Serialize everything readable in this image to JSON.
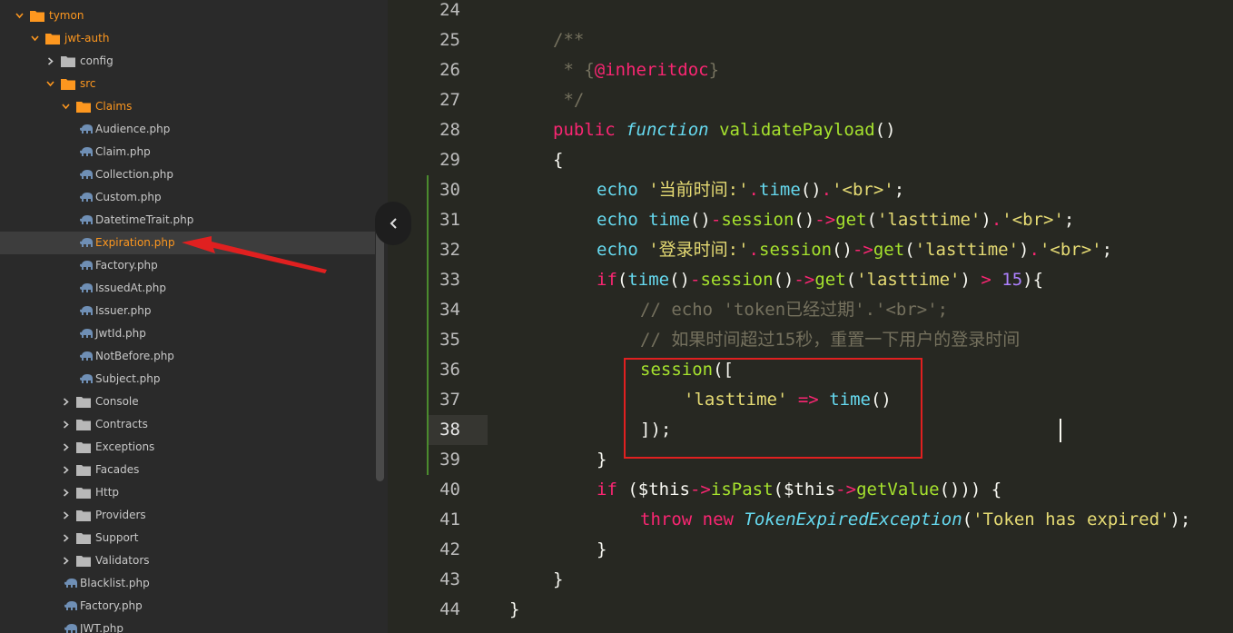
{
  "sidebar": {
    "items": [
      {
        "label": "tymon",
        "type": "folder",
        "expanded": true,
        "level": 0,
        "color": "orange"
      },
      {
        "label": "jwt-auth",
        "type": "folder",
        "expanded": true,
        "level": 1,
        "color": "orange"
      },
      {
        "label": "config",
        "type": "folder",
        "expanded": false,
        "level": 2,
        "color": "grey"
      },
      {
        "label": "src",
        "type": "folder",
        "expanded": true,
        "level": 2,
        "color": "orange"
      },
      {
        "label": "Claims",
        "type": "folder",
        "expanded": true,
        "level": 3,
        "color": "orange"
      },
      {
        "label": "Audience.php",
        "type": "file",
        "level": 4
      },
      {
        "label": "Claim.php",
        "type": "file",
        "level": 4
      },
      {
        "label": "Collection.php",
        "type": "file",
        "level": 4
      },
      {
        "label": "Custom.php",
        "type": "file",
        "level": 4
      },
      {
        "label": "DatetimeTrait.php",
        "type": "file",
        "level": 4
      },
      {
        "label": "Expiration.php",
        "type": "file",
        "level": 4,
        "selected": true
      },
      {
        "label": "Factory.php",
        "type": "file",
        "level": 4
      },
      {
        "label": "IssuedAt.php",
        "type": "file",
        "level": 4
      },
      {
        "label": "Issuer.php",
        "type": "file",
        "level": 4
      },
      {
        "label": "JwtId.php",
        "type": "file",
        "level": 4
      },
      {
        "label": "NotBefore.php",
        "type": "file",
        "level": 4
      },
      {
        "label": "Subject.php",
        "type": "file",
        "level": 4
      },
      {
        "label": "Console",
        "type": "folder",
        "expanded": false,
        "level": 3,
        "color": "grey"
      },
      {
        "label": "Contracts",
        "type": "folder",
        "expanded": false,
        "level": 3,
        "color": "grey"
      },
      {
        "label": "Exceptions",
        "type": "folder",
        "expanded": false,
        "level": 3,
        "color": "grey"
      },
      {
        "label": "Facades",
        "type": "folder",
        "expanded": false,
        "level": 3,
        "color": "grey"
      },
      {
        "label": "Http",
        "type": "folder",
        "expanded": false,
        "level": 3,
        "color": "grey"
      },
      {
        "label": "Providers",
        "type": "folder",
        "expanded": false,
        "level": 3,
        "color": "grey"
      },
      {
        "label": "Support",
        "type": "folder",
        "expanded": false,
        "level": 3,
        "color": "grey"
      },
      {
        "label": "Validators",
        "type": "folder",
        "expanded": false,
        "level": 3,
        "color": "grey"
      },
      {
        "label": "Blacklist.php",
        "type": "file",
        "level": 3
      },
      {
        "label": "Factory.php",
        "type": "file",
        "level": 3
      },
      {
        "label": "JWT.php",
        "type": "file",
        "level": 3
      }
    ]
  },
  "editor": {
    "line_numbers": [
      "24",
      "25",
      "26",
      "27",
      "28",
      "29",
      "30",
      "31",
      "32",
      "33",
      "34",
      "35",
      "36",
      "37",
      "38",
      "39",
      "40",
      "41",
      "42",
      "43",
      "44"
    ],
    "active_line": "38",
    "lines": [
      [],
      [
        {
          "t": "/**",
          "c": "c-com"
        }
      ],
      [
        {
          "t": " * ",
          "c": "c-com"
        },
        {
          "t": "{",
          "c": "c-com"
        },
        {
          "t": "@inheritdoc",
          "c": "c-kw"
        },
        {
          "t": "}",
          "c": "c-com"
        }
      ],
      [
        {
          "t": " */",
          "c": "c-com"
        }
      ],
      [
        {
          "t": "public",
          "c": "c-kw"
        },
        {
          "t": " ",
          "c": "c-plain"
        },
        {
          "t": "function",
          "c": "c-type"
        },
        {
          "t": " ",
          "c": "c-plain"
        },
        {
          "t": "validatePayload",
          "c": "c-fn"
        },
        {
          "t": "()",
          "c": "c-plain"
        }
      ],
      [
        {
          "t": "{",
          "c": "c-plain"
        }
      ],
      [
        {
          "t": "echo",
          "c": "c-bi"
        },
        {
          "t": " ",
          "c": "c-plain"
        },
        {
          "t": "'当前时间:'",
          "c": "c-str"
        },
        {
          "t": ".",
          "c": "c-kw"
        },
        {
          "t": "time",
          "c": "c-bi"
        },
        {
          "t": "()",
          "c": "c-plain"
        },
        {
          "t": ".",
          "c": "c-kw"
        },
        {
          "t": "'<br>'",
          "c": "c-str"
        },
        {
          "t": ";",
          "c": "c-plain"
        }
      ],
      [
        {
          "t": "echo",
          "c": "c-bi"
        },
        {
          "t": " ",
          "c": "c-plain"
        },
        {
          "t": "time",
          "c": "c-bi"
        },
        {
          "t": "()",
          "c": "c-plain"
        },
        {
          "t": "-",
          "c": "c-kw"
        },
        {
          "t": "session",
          "c": "c-fn"
        },
        {
          "t": "()",
          "c": "c-plain"
        },
        {
          "t": "->",
          "c": "c-kw"
        },
        {
          "t": "get",
          "c": "c-fn"
        },
        {
          "t": "(",
          "c": "c-plain"
        },
        {
          "t": "'lasttime'",
          "c": "c-str"
        },
        {
          "t": ")",
          "c": "c-plain"
        },
        {
          "t": ".",
          "c": "c-kw"
        },
        {
          "t": "'<br>'",
          "c": "c-str"
        },
        {
          "t": ";",
          "c": "c-plain"
        }
      ],
      [
        {
          "t": "echo",
          "c": "c-bi"
        },
        {
          "t": " ",
          "c": "c-plain"
        },
        {
          "t": "'登录时间:'",
          "c": "c-str"
        },
        {
          "t": ".",
          "c": "c-kw"
        },
        {
          "t": "session",
          "c": "c-fn"
        },
        {
          "t": "()",
          "c": "c-plain"
        },
        {
          "t": "->",
          "c": "c-kw"
        },
        {
          "t": "get",
          "c": "c-fn"
        },
        {
          "t": "(",
          "c": "c-plain"
        },
        {
          "t": "'lasttime'",
          "c": "c-str"
        },
        {
          "t": ")",
          "c": "c-plain"
        },
        {
          "t": ".",
          "c": "c-kw"
        },
        {
          "t": "'<br>'",
          "c": "c-str"
        },
        {
          "t": ";",
          "c": "c-plain"
        }
      ],
      [
        {
          "t": "if",
          "c": "c-kw"
        },
        {
          "t": "(",
          "c": "c-plain"
        },
        {
          "t": "time",
          "c": "c-bi"
        },
        {
          "t": "()",
          "c": "c-plain"
        },
        {
          "t": "-",
          "c": "c-kw"
        },
        {
          "t": "session",
          "c": "c-fn"
        },
        {
          "t": "()",
          "c": "c-plain"
        },
        {
          "t": "->",
          "c": "c-kw"
        },
        {
          "t": "get",
          "c": "c-fn"
        },
        {
          "t": "(",
          "c": "c-plain"
        },
        {
          "t": "'lasttime'",
          "c": "c-str"
        },
        {
          "t": ") ",
          "c": "c-plain"
        },
        {
          "t": ">",
          "c": "c-kw"
        },
        {
          "t": " ",
          "c": "c-plain"
        },
        {
          "t": "15",
          "c": "c-num"
        },
        {
          "t": "){",
          "c": "c-plain"
        }
      ],
      [
        {
          "t": "// echo 'token已经过期'.'<br>';",
          "c": "c-com"
        }
      ],
      [
        {
          "t": "// 如果时间超过15秒，重置一下用户的登录时间",
          "c": "c-com"
        }
      ],
      [
        {
          "t": "session",
          "c": "c-fn"
        },
        {
          "t": "([",
          "c": "c-plain"
        }
      ],
      [
        {
          "t": "'lasttime'",
          "c": "c-str"
        },
        {
          "t": " ",
          "c": "c-plain"
        },
        {
          "t": "=>",
          "c": "c-kw"
        },
        {
          "t": " ",
          "c": "c-plain"
        },
        {
          "t": "time",
          "c": "c-bi"
        },
        {
          "t": "()",
          "c": "c-plain"
        }
      ],
      [
        {
          "t": "]);",
          "c": "c-plain"
        }
      ],
      [
        {
          "t": "}",
          "c": "c-plain"
        }
      ],
      [
        {
          "t": "if",
          "c": "c-kw"
        },
        {
          "t": " (",
          "c": "c-plain"
        },
        {
          "t": "$this",
          "c": "c-plain"
        },
        {
          "t": "->",
          "c": "c-kw"
        },
        {
          "t": "isPast",
          "c": "c-fn"
        },
        {
          "t": "(",
          "c": "c-plain"
        },
        {
          "t": "$this",
          "c": "c-plain"
        },
        {
          "t": "->",
          "c": "c-kw"
        },
        {
          "t": "getValue",
          "c": "c-fn"
        },
        {
          "t": "())) {",
          "c": "c-plain"
        }
      ],
      [
        {
          "t": "throw",
          "c": "c-kw"
        },
        {
          "t": " ",
          "c": "c-plain"
        },
        {
          "t": "new",
          "c": "c-kw"
        },
        {
          "t": " ",
          "c": "c-plain"
        },
        {
          "t": "TokenExpiredException",
          "c": "c-ital"
        },
        {
          "t": "(",
          "c": "c-plain"
        },
        {
          "t": "'Token has expired'",
          "c": "c-str"
        },
        {
          "t": ");",
          "c": "c-plain"
        }
      ],
      [
        {
          "t": "}",
          "c": "c-plain"
        }
      ],
      [
        {
          "t": "}",
          "c": "c-plain"
        }
      ],
      [
        {
          "t": "}",
          "c": "c-plain"
        }
      ]
    ],
    "indents": [
      0,
      1,
      1,
      1,
      1,
      1,
      2,
      2,
      2,
      2,
      3,
      3,
      3,
      4,
      3,
      2,
      2,
      3,
      2,
      1,
      0
    ]
  },
  "colors": {
    "orange_folder": "#fd971f",
    "grey_folder": "#b8b8b8",
    "php_icon": "#6f8fb5",
    "annotation_red": "#e02020"
  }
}
